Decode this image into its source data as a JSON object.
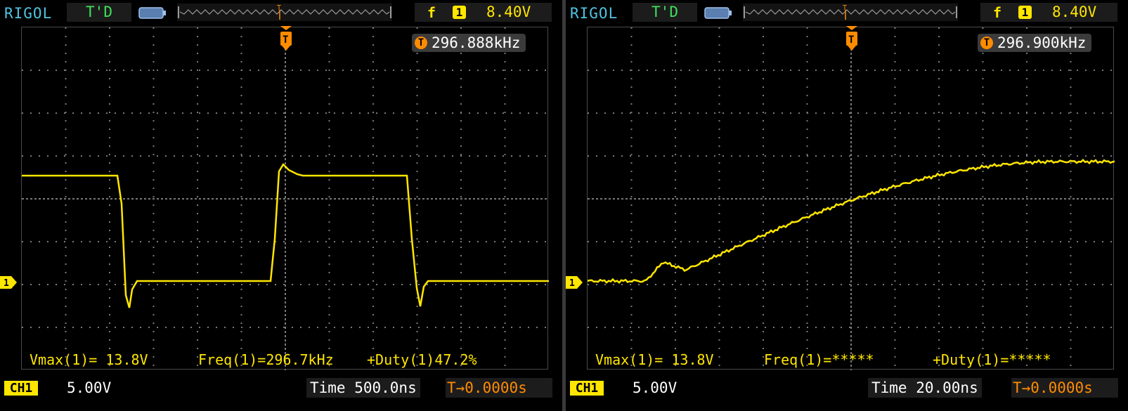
{
  "scopes": [
    {
      "brand": "RIGOL",
      "status": "T'D",
      "trigger_edge_symbol": "f",
      "trigger_source": "1",
      "trigger_level": "8.40V",
      "frequency_counter": "296.888kHz",
      "trigger_marker": "T",
      "channel_marker": "1",
      "measurements": {
        "vmax": "Vmax(1)= 13.8V",
        "freq": "Freq(1)=296.7kHz",
        "duty": "+Duty(1)47.2%"
      },
      "channel_label": "CH1",
      "volts_per_div": "5.00V",
      "timebase": "Time 500.0ns",
      "trigger_offset": "T→0.0000s",
      "colors": {
        "trace": "#ffe600",
        "brand": "#4fc3e0",
        "status": "#3ee05a",
        "trigger": "#ff8c00"
      },
      "waveform": "square-wave"
    },
    {
      "brand": "RIGOL",
      "status": "T'D",
      "trigger_edge_symbol": "f",
      "trigger_source": "1",
      "trigger_level": "8.40V",
      "frequency_counter": "296.900kHz",
      "trigger_marker": "T",
      "channel_marker": "1",
      "measurements": {
        "vmax": "Vmax(1)= 13.8V",
        "freq": "Freq(1)=*****",
        "duty": "+Duty(1)=*****"
      },
      "channel_label": "CH1",
      "volts_per_div": "5.00V",
      "timebase": "Time 20.00ns",
      "trigger_offset": "T→0.0000s",
      "colors": {
        "trace": "#ffe600",
        "brand": "#4fc3e0",
        "status": "#3ee05a",
        "trigger": "#ff8c00"
      },
      "waveform": "rising-edge"
    }
  ]
}
